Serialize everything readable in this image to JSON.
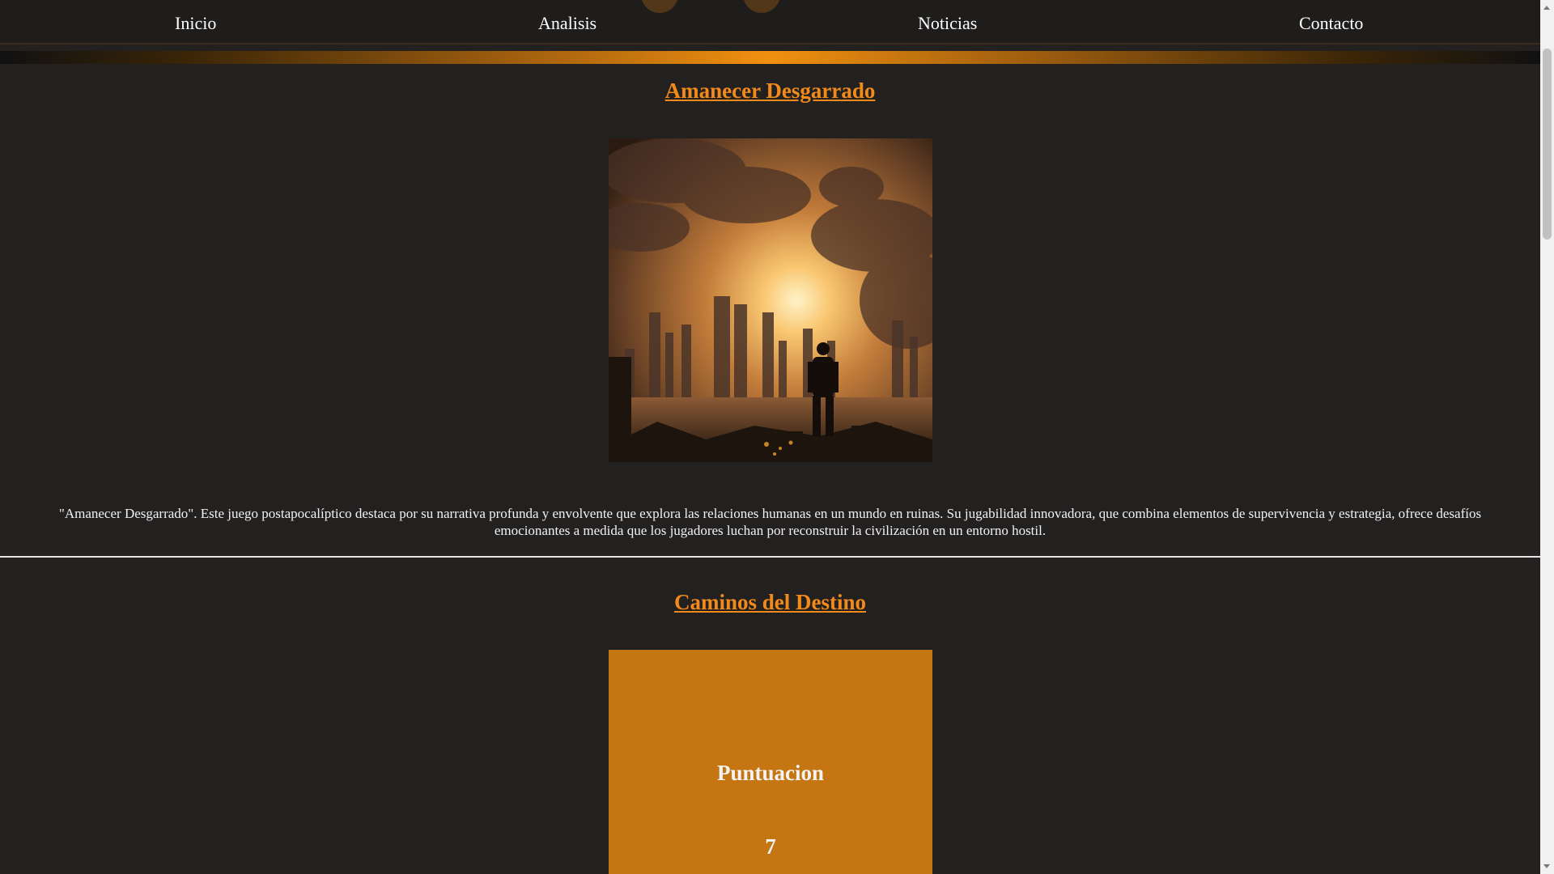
{
  "nav": {
    "items": [
      {
        "label": "Inicio"
      },
      {
        "label": "Analisis"
      },
      {
        "label": "Noticias"
      },
      {
        "label": "Contacto"
      }
    ]
  },
  "colors": {
    "background": "#232020",
    "accent": "#f18a1b",
    "score_card": "#c57612"
  },
  "articles": [
    {
      "title": "Amanecer Desgarrado",
      "image_icon": "post-apocalyptic-city-illustration",
      "description": "\"Amanecer Desgarrado\". Este juego postapocalíptico destaca por su narrativa profunda y envolvente que explora las relaciones humanas en un mundo en ruinas. Su jugabilidad innovadora, que combina elementos de supervivencia y estrategia, ofrece desafíos emocionantes a medida que los jugadores luchan por reconstruir la civilización en un entorno hostil."
    },
    {
      "title": "Caminos del Destino",
      "score_label": "Puntuacion",
      "score_value": "7"
    }
  ]
}
